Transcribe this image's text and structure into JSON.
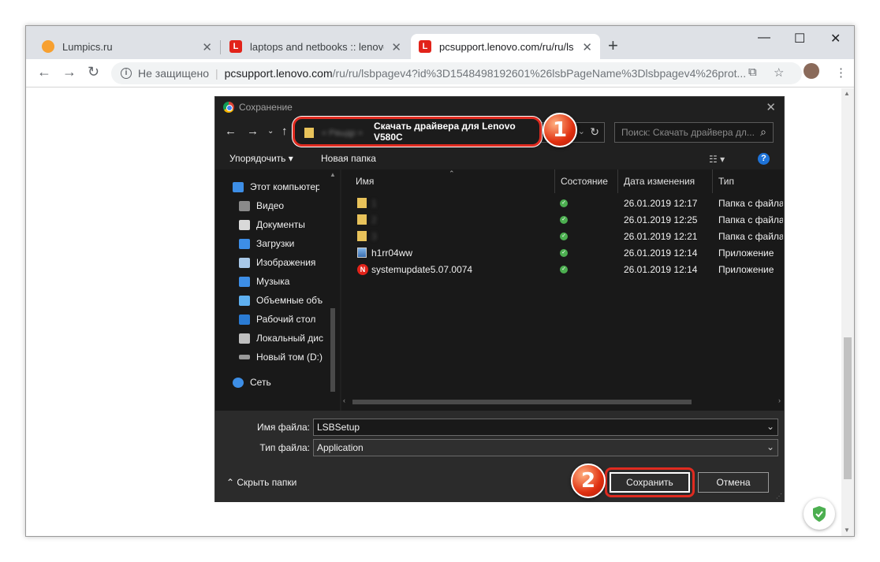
{
  "browser": {
    "tabs": [
      {
        "label": "Lumpics.ru",
        "icon": "lumpics-favicon",
        "active": false
      },
      {
        "label": "laptops and netbooks :: lenovo v",
        "icon": "lenovo-favicon",
        "active": false
      },
      {
        "label": "pcsupport.lenovo.com/ru/ru/lsbp",
        "icon": "lenovo-favicon",
        "active": true
      }
    ],
    "new_tab": "+",
    "window_controls": {
      "minimize": "—",
      "maximize": "☐",
      "close": "✕"
    },
    "address": {
      "security": "Не защищено",
      "host": "pcsupport.lenovo.com",
      "path": "/ru/ru/lsbpagev4?id%3D1548498192601%26lsbPageName%3Dlsbpagev4%26prot..."
    }
  },
  "dialog": {
    "title": "Сохранение",
    "breadcrumb_current": "Скачать драйвера для Lenovo V580C",
    "breadcrumb_blurred": "« Рвыдр »",
    "search_placeholder": "Поиск: Скачать драйвера дл...",
    "toolbar": {
      "organize": "Упорядочить ▾",
      "new_folder": "Новая папка"
    },
    "nav_items": [
      {
        "label": "Этот компьютер",
        "icon": "computer-icon",
        "color": "#3d8ee6",
        "top": true
      },
      {
        "label": "Видео",
        "icon": "video-icon",
        "color": "#8a8a8a"
      },
      {
        "label": "Документы",
        "icon": "documents-icon",
        "color": "#d9d9d9"
      },
      {
        "label": "Загрузки",
        "icon": "downloads-icon",
        "color": "#3d8ee6"
      },
      {
        "label": "Изображения",
        "icon": "pictures-icon",
        "color": "#a8c8e8"
      },
      {
        "label": "Музыка",
        "icon": "music-icon",
        "color": "#3d8ee6"
      },
      {
        "label": "Объемные объ",
        "icon": "3d-objects-icon",
        "color": "#5fb0f0"
      },
      {
        "label": "Рабочий стол",
        "icon": "desktop-icon",
        "color": "#2a7bd4"
      },
      {
        "label": "Локальный дис",
        "icon": "local-disk-icon",
        "color": "#bfbfbf"
      },
      {
        "label": "Новый том (D:)",
        "icon": "drive-icon",
        "color": "#9a9a9a"
      },
      {
        "label": "Сеть",
        "icon": "network-icon",
        "color": "#3d8ee6",
        "top": true
      }
    ],
    "columns": {
      "name": "Имя",
      "status": "Состояние",
      "date": "Дата изменения",
      "type": "Тип"
    },
    "files": [
      {
        "name": "1",
        "blurred": true,
        "date": "26.01.2019 12:17",
        "type": "Папка с файла",
        "icon": "folder-icon"
      },
      {
        "name": "2",
        "blurred": true,
        "date": "26.01.2019 12:25",
        "type": "Папка с файла",
        "icon": "folder-icon"
      },
      {
        "name": "3",
        "blurred": true,
        "date": "26.01.2019 12:21",
        "type": "Папка с файла",
        "icon": "folder-icon"
      },
      {
        "name": "h1rr04ww",
        "blurred": false,
        "date": "26.01.2019 12:14",
        "type": "Приложение",
        "icon": "installer-icon"
      },
      {
        "name": "systemupdate5.07.0074",
        "blurred": false,
        "date": "26.01.2019 12:14",
        "type": "Приложение",
        "icon": "lenovo-update-icon"
      }
    ],
    "filename_label": "Имя файла:",
    "filename_value": "LSBSetup",
    "filetype_label": "Тип файла:",
    "filetype_value": "Application",
    "hide_folders": "Скрыть папки",
    "save_button": "Сохранить",
    "cancel_button": "Отмена"
  },
  "annotations": {
    "step1": "1",
    "step2": "2"
  },
  "colors": {
    "accent_red": "#e02b20",
    "dialog_bg": "#202020",
    "ok_green": "#4caf50"
  }
}
